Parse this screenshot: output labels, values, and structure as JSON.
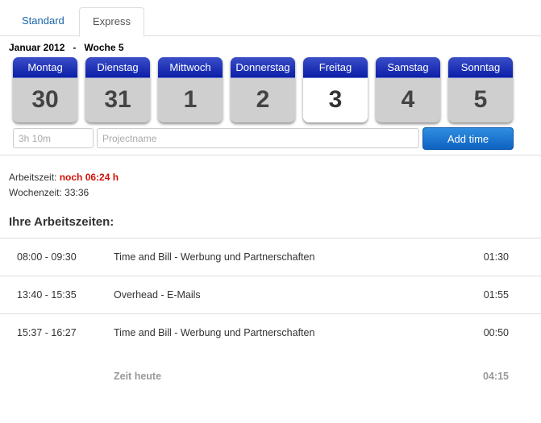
{
  "tabs": [
    {
      "label": "Standard"
    },
    {
      "label": "Express"
    }
  ],
  "header": {
    "month": "Januar 2012",
    "separator": "-",
    "week": "Woche 5"
  },
  "days": [
    {
      "name": "Montag",
      "num": "30"
    },
    {
      "name": "Dienstag",
      "num": "31"
    },
    {
      "name": "Mittwoch",
      "num": "1"
    },
    {
      "name": "Donnerstag",
      "num": "2"
    },
    {
      "name": "Freitag",
      "num": "3"
    },
    {
      "name": "Samstag",
      "num": "4"
    },
    {
      "name": "Sonntag",
      "num": "5"
    }
  ],
  "entry_form": {
    "time_placeholder": "3h 10m",
    "project_placeholder": "Projectname",
    "add_label": "Add time"
  },
  "stats": {
    "arbeitszeit_label": "Arbeitszeit:",
    "arbeitszeit_value": "noch 06:24 h",
    "wochenzeit_label": "Wochenzeit:",
    "wochenzeit_value": "33:36"
  },
  "section_title": "Ihre Arbeitszeiten:",
  "entries": [
    {
      "time": "08:00 - 09:30",
      "project": "Time and Bill - Werbung und Partnerschaften",
      "duration": "01:30"
    },
    {
      "time": "13:40 - 15:35",
      "project": "Overhead - E-Mails",
      "duration": "01:55"
    },
    {
      "time": "15:37 - 16:27",
      "project": "Time and Bill - Werbung und Partnerschaften",
      "duration": "00:50"
    }
  ],
  "total": {
    "label": "Zeit heute",
    "value": "04:15"
  },
  "colors": {
    "accent_blue": "#1a64a9",
    "day_header": "#0b1ea8",
    "warning_red": "#d0120a"
  }
}
